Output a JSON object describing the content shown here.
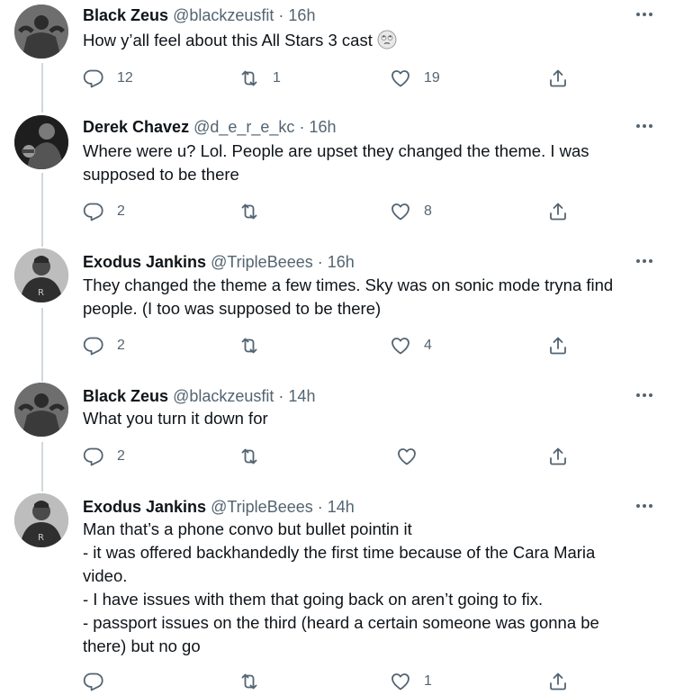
{
  "tweets": [
    {
      "name": "Black Zeus",
      "handle": "@blackzeusfit",
      "dot": "·",
      "time": "16h",
      "lines": [
        "How y’all feel about this All Stars 3 cast"
      ],
      "emoji": "rolling-eyes-emoji",
      "replies": "12",
      "retweets": "1",
      "likes": "19"
    },
    {
      "name": "Derek Chavez",
      "handle": "@d_e_r_e_kc",
      "dot": "·",
      "time": "16h",
      "lines": [
        "Where were u? Lol. People are upset they changed the theme. I was",
        "supposed to be there"
      ],
      "replies": "2",
      "retweets": "",
      "likes": "8"
    },
    {
      "name": "Exodus Jankins",
      "handle": "@TripleBeees",
      "dot": "·",
      "time": "16h",
      "lines": [
        "They changed the theme a few times. Sky was on sonic mode tryna find",
        "people. (I too was supposed to be there)"
      ],
      "replies": "2",
      "retweets": "",
      "likes": "4"
    },
    {
      "name": "Black Zeus",
      "handle": "@blackzeusfit",
      "dot": "·",
      "time": "14h",
      "lines": [
        "What you turn it down for"
      ],
      "replies": "2",
      "retweets": "",
      "likes": ""
    },
    {
      "name": "Exodus Jankins",
      "handle": "@TripleBeees",
      "dot": "·",
      "time": "14h",
      "lines": [
        "Man that’s a phone convo but bullet pointin it",
        "- it was offered backhandedly the first time because of the Cara Maria",
        "video.",
        "- I have issues with them that going back on aren’t going to fix.",
        "- passport issues on the third (heard a certain someone was gonna be",
        "there) but no go"
      ],
      "replies": "",
      "retweets": "",
      "likes": "1"
    }
  ],
  "colors": {
    "text": "#0f1419",
    "secondary": "#536471",
    "thread": "#cfd9de"
  }
}
